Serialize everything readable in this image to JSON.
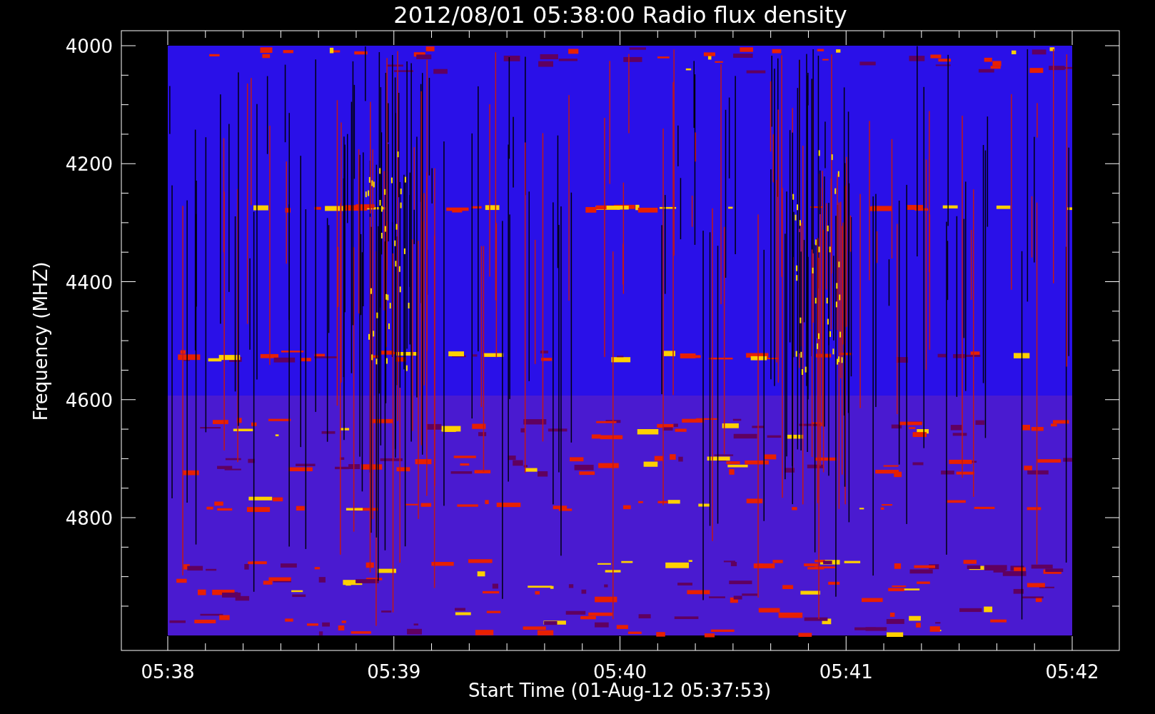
{
  "title": "2012/08/01 05:38:00 Radio flux density",
  "ylabel": "Frequency (MHZ)",
  "xlabel": "Start Time (01-Aug-12 05:37:53)",
  "yticks": [
    "4000",
    "4200",
    "4400",
    "4600",
    "4800"
  ],
  "xticks": [
    "05:38",
    "05:39",
    "05:40",
    "05:41",
    "05:42"
  ]
}
